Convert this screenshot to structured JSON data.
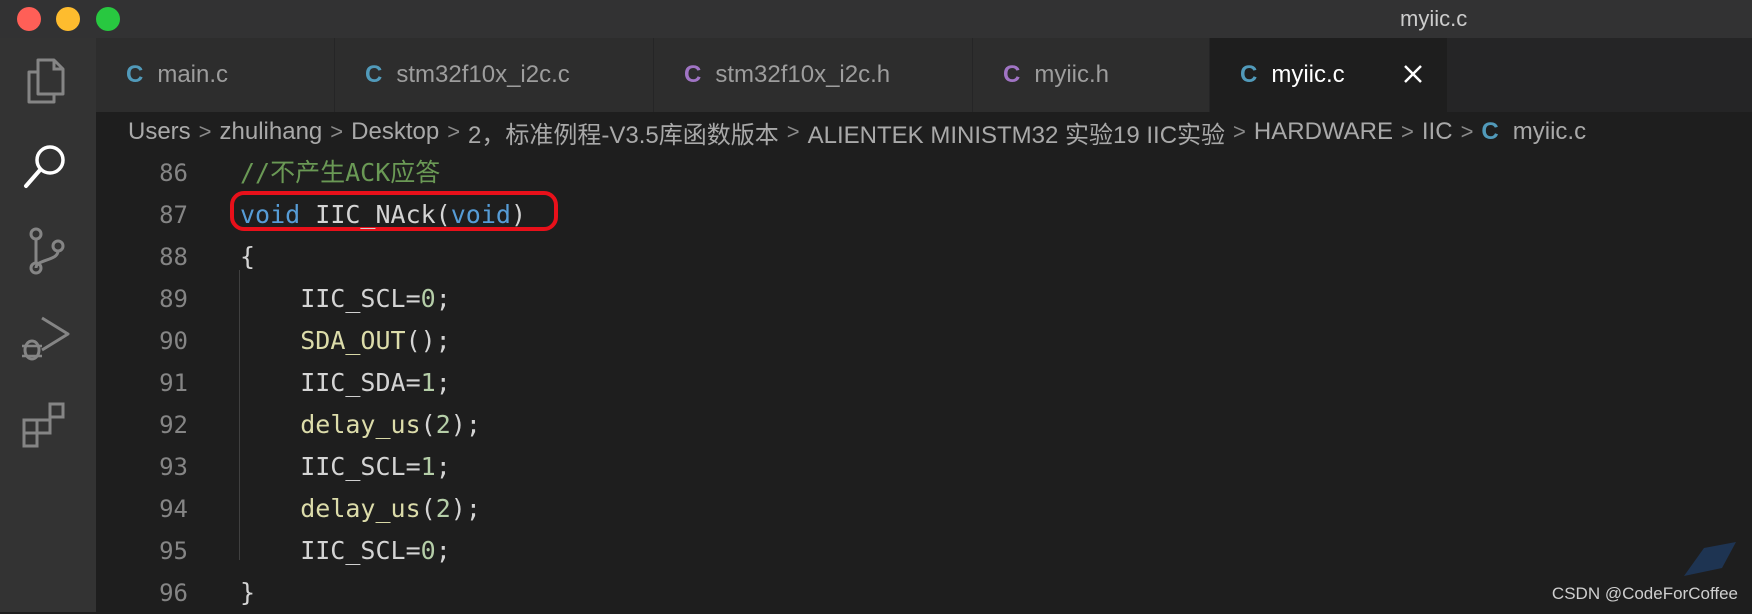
{
  "window": {
    "title": "myiic.c"
  },
  "activity_bar": {
    "items": [
      "explorer-icon",
      "search-icon",
      "source-control-icon",
      "run-debug-icon",
      "extensions-icon"
    ]
  },
  "tabs": [
    {
      "lang": "C",
      "label": "main.c",
      "lang_color": "#519aba"
    },
    {
      "lang": "C",
      "label": "stm32f10x_i2c.c",
      "lang_color": "#519aba"
    },
    {
      "lang": "C",
      "label": "stm32f10x_i2c.h",
      "lang_color": "#a074c4"
    },
    {
      "lang": "C",
      "label": "myiic.h",
      "lang_color": "#a074c4"
    },
    {
      "lang": "C",
      "label": "myiic.c",
      "lang_color": "#519aba",
      "active": true
    }
  ],
  "breadcrumb": {
    "items": [
      "Users",
      "zhulihang",
      "Desktop",
      "2，标准例程-V3.5库函数版本",
      "ALIENTEK MINISTM32 实验19 IIC实验",
      "HARDWARE",
      "IIC"
    ],
    "file_lang": "C",
    "file": "myiic.c"
  },
  "editor": {
    "lines": [
      {
        "num": "86",
        "tokens": [
          [
            "//不产生ACK应答",
            "c-comment"
          ]
        ]
      },
      {
        "num": "87",
        "tokens": [
          [
            "void",
            "c-kw"
          ],
          [
            " IIC_NAck(",
            "c-plain"
          ],
          [
            "void",
            "c-kw"
          ],
          [
            ")",
            "c-plain"
          ]
        ]
      },
      {
        "num": "88",
        "tokens": [
          [
            "{",
            "c-plain"
          ]
        ]
      },
      {
        "num": "89",
        "tokens": [
          [
            "    IIC_SCL=",
            "c-plain"
          ],
          [
            "0",
            "c-num"
          ],
          [
            ";",
            "c-plain"
          ]
        ]
      },
      {
        "num": "90",
        "tokens": [
          [
            "    ",
            "c-plain"
          ],
          [
            "SDA_OUT",
            "c-fn"
          ],
          [
            "();",
            "c-plain"
          ]
        ]
      },
      {
        "num": "91",
        "tokens": [
          [
            "    IIC_SDA=",
            "c-plain"
          ],
          [
            "1",
            "c-num"
          ],
          [
            ";",
            "c-plain"
          ]
        ]
      },
      {
        "num": "92",
        "tokens": [
          [
            "    ",
            "c-plain"
          ],
          [
            "delay_us",
            "c-fn"
          ],
          [
            "(",
            "c-plain"
          ],
          [
            "2",
            "c-num"
          ],
          [
            ");",
            "c-plain"
          ]
        ]
      },
      {
        "num": "93",
        "tokens": [
          [
            "    IIC_SCL=",
            "c-plain"
          ],
          [
            "1",
            "c-num"
          ],
          [
            ";",
            "c-plain"
          ]
        ]
      },
      {
        "num": "94",
        "tokens": [
          [
            "    ",
            "c-plain"
          ],
          [
            "delay_us",
            "c-fn"
          ],
          [
            "(",
            "c-plain"
          ],
          [
            "2",
            "c-num"
          ],
          [
            ");",
            "c-plain"
          ]
        ]
      },
      {
        "num": "95",
        "tokens": [
          [
            "    IIC_SCL=",
            "c-plain"
          ],
          [
            "0",
            "c-num"
          ],
          [
            ";",
            "c-plain"
          ]
        ]
      },
      {
        "num": "96",
        "tokens": [
          [
            "}",
            "c-plain"
          ]
        ]
      }
    ],
    "highlighted_line": "87",
    "highlight_color": "#e8101a"
  },
  "watermark": {
    "text": "CSDN @CodeForCoffee"
  },
  "colors": {
    "keyword": "#569cd6",
    "function": "#dcdcaa",
    "number": "#b5cea8",
    "comment": "#6a9955",
    "line_number": "#858585"
  }
}
